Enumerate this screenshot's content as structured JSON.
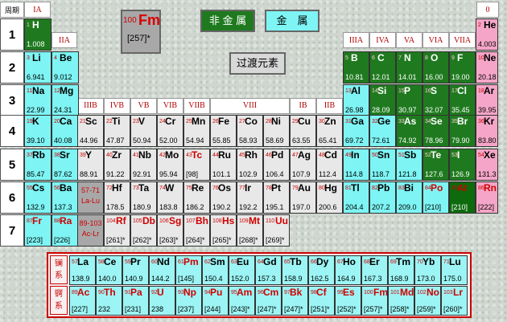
{
  "corner": "周期",
  "periods": [
    "1",
    "2",
    "3",
    "4",
    "5",
    "6",
    "7"
  ],
  "groups_main": {
    "IA": "IA",
    "IIA": "IIA",
    "IIIA": "IIIA",
    "IVA": "IVA",
    "VA": "VA",
    "VIA": "VIA",
    "VIIA": "VIIA",
    "0": "0"
  },
  "groups_trans": [
    "IIIB",
    "IVB",
    "VB",
    "VIB",
    "VIIB",
    "VIII",
    "IB",
    "IIB"
  ],
  "legend": {
    "nonmetal": "非 金 属",
    "metal": "金　属",
    "transition": "过渡元素"
  },
  "sample": {
    "z": "100",
    "symbol": "Fm",
    "mass": "[257]*"
  },
  "colors": {
    "alkali": "#7ef4f4",
    "transition": "#e8e8e8",
    "metal": "#7ef4f4",
    "nonmetal": "#1f7a1f",
    "metalloid": "#0d6b0d",
    "noble": "#f5a6c8",
    "sample_bg": "#a8a8a8",
    "series": "#9cf4f4"
  },
  "elements": [
    {
      "z": "1",
      "s": "H",
      "m": "1.008",
      "c": "nonmetal",
      "r": 1,
      "g": 1
    },
    {
      "z": "2",
      "s": "He",
      "m": "4.003",
      "c": "noble",
      "r": 1,
      "g": 18
    },
    {
      "z": "3",
      "s": "Li",
      "m": "6.941",
      "c": "metal",
      "r": 2,
      "g": 1
    },
    {
      "z": "4",
      "s": "Be",
      "m": "9.012",
      "c": "metal",
      "r": 2,
      "g": 2
    },
    {
      "z": "5",
      "s": "B",
      "m": "10.81",
      "c": "nonmetal",
      "r": 2,
      "g": 13
    },
    {
      "z": "6",
      "s": "C",
      "m": "12.01",
      "c": "nonmetal",
      "r": 2,
      "g": 14
    },
    {
      "z": "7",
      "s": "N",
      "m": "14.01",
      "c": "nonmetal",
      "r": 2,
      "g": 15
    },
    {
      "z": "8",
      "s": "O",
      "m": "16.00",
      "c": "nonmetal",
      "r": 2,
      "g": 16
    },
    {
      "z": "9",
      "s": "F",
      "m": "19.00",
      "c": "nonmetal",
      "r": 2,
      "g": 17
    },
    {
      "z": "10",
      "s": "Ne",
      "m": "20.18",
      "c": "noble",
      "r": 2,
      "g": 18
    },
    {
      "z": "11",
      "s": "Na",
      "m": "22.99",
      "c": "metal",
      "r": 3,
      "g": 1
    },
    {
      "z": "12",
      "s": "Mg",
      "m": "24.31",
      "c": "metal",
      "r": 3,
      "g": 2
    },
    {
      "z": "13",
      "s": "Al",
      "m": "26.98",
      "c": "metal",
      "r": 3,
      "g": 13
    },
    {
      "z": "14",
      "s": "Si",
      "m": "28.09",
      "c": "nonmetal",
      "r": 3,
      "g": 14
    },
    {
      "z": "15",
      "s": "P",
      "m": "30.97",
      "c": "nonmetal",
      "r": 3,
      "g": 15
    },
    {
      "z": "16",
      "s": "S",
      "m": "32.07",
      "c": "nonmetal",
      "r": 3,
      "g": 16
    },
    {
      "z": "17",
      "s": "Cl",
      "m": "35.45",
      "c": "nonmetal",
      "r": 3,
      "g": 17
    },
    {
      "z": "18",
      "s": "Ar",
      "m": "39.95",
      "c": "noble",
      "r": 3,
      "g": 18
    },
    {
      "z": "19",
      "s": "K",
      "m": "39.10",
      "c": "metal",
      "r": 4,
      "g": 1
    },
    {
      "z": "20",
      "s": "Ca",
      "m": "40.08",
      "c": "metal",
      "r": 4,
      "g": 2
    },
    {
      "z": "21",
      "s": "Sc",
      "m": "44.96",
      "c": "transition",
      "r": 4,
      "g": 3
    },
    {
      "z": "22",
      "s": "Ti",
      "m": "47.87",
      "c": "transition",
      "r": 4,
      "g": 4
    },
    {
      "z": "23",
      "s": "V",
      "m": "50.94",
      "c": "transition",
      "r": 4,
      "g": 5
    },
    {
      "z": "24",
      "s": "Cr",
      "m": "52.00",
      "c": "transition",
      "r": 4,
      "g": 6
    },
    {
      "z": "25",
      "s": "Mn",
      "m": "54.94",
      "c": "transition",
      "r": 4,
      "g": 7
    },
    {
      "z": "26",
      "s": "Fe",
      "m": "55.85",
      "c": "transition",
      "r": 4,
      "g": 8
    },
    {
      "z": "27",
      "s": "Co",
      "m": "58.93",
      "c": "transition",
      "r": 4,
      "g": 9
    },
    {
      "z": "28",
      "s": "Ni",
      "m": "58.69",
      "c": "transition",
      "r": 4,
      "g": 10
    },
    {
      "z": "29",
      "s": "Cu",
      "m": "63.55",
      "c": "transition",
      "r": 4,
      "g": 11
    },
    {
      "z": "30",
      "s": "Zn",
      "m": "65.41",
      "c": "transition",
      "r": 4,
      "g": 12
    },
    {
      "z": "31",
      "s": "Ga",
      "m": "69.72",
      "c": "metal",
      "r": 4,
      "g": 13
    },
    {
      "z": "32",
      "s": "Ge",
      "m": "72.61",
      "c": "metal",
      "r": 4,
      "g": 14
    },
    {
      "z": "33",
      "s": "As",
      "m": "74.92",
      "c": "nonmetal",
      "r": 4,
      "g": 15
    },
    {
      "z": "34",
      "s": "Se",
      "m": "78.96",
      "c": "nonmetal",
      "r": 4,
      "g": 16
    },
    {
      "z": "35",
      "s": "Br",
      "m": "79.90",
      "c": "nonmetal",
      "r": 4,
      "g": 17
    },
    {
      "z": "36",
      "s": "Kr",
      "m": "83.80",
      "c": "noble",
      "r": 4,
      "g": 18
    },
    {
      "z": "37",
      "s": "Rb",
      "m": "85.47",
      "c": "metal",
      "r": 5,
      "g": 1
    },
    {
      "z": "38",
      "s": "Sr",
      "m": "87.62",
      "c": "metal",
      "r": 5,
      "g": 2
    },
    {
      "z": "39",
      "s": "Y",
      "m": "88.91",
      "c": "transition",
      "r": 5,
      "g": 3
    },
    {
      "z": "40",
      "s": "Zr",
      "m": "91.22",
      "c": "transition",
      "r": 5,
      "g": 4
    },
    {
      "z": "41",
      "s": "Nb",
      "m": "92.91",
      "c": "transition",
      "r": 5,
      "g": 5
    },
    {
      "z": "42",
      "s": "Mo",
      "m": "95.94",
      "c": "transition",
      "r": 5,
      "g": 6
    },
    {
      "z": "43",
      "s": "Tc",
      "m": "[98]",
      "c": "transition",
      "r": 5,
      "g": 7,
      "red": true
    },
    {
      "z": "44",
      "s": "Ru",
      "m": "101.1",
      "c": "transition",
      "r": 5,
      "g": 8
    },
    {
      "z": "45",
      "s": "Rh",
      "m": "102.9",
      "c": "transition",
      "r": 5,
      "g": 9
    },
    {
      "z": "46",
      "s": "Pd",
      "m": "106.4",
      "c": "transition",
      "r": 5,
      "g": 10
    },
    {
      "z": "47",
      "s": "Ag",
      "m": "107.9",
      "c": "transition",
      "r": 5,
      "g": 11
    },
    {
      "z": "48",
      "s": "Cd",
      "m": "112.4",
      "c": "transition",
      "r": 5,
      "g": 12
    },
    {
      "z": "49",
      "s": "In",
      "m": "114.8",
      "c": "metal",
      "r": 5,
      "g": 13
    },
    {
      "z": "50",
      "s": "Sn",
      "m": "118.7",
      "c": "metal",
      "r": 5,
      "g": 14
    },
    {
      "z": "51",
      "s": "Sb",
      "m": "121.8",
      "c": "metal",
      "r": 5,
      "g": 15
    },
    {
      "z": "52",
      "s": "Te",
      "m": "127.6",
      "c": "nonmetal",
      "r": 5,
      "g": 16
    },
    {
      "z": "53",
      "s": "I",
      "m": "126.9",
      "c": "nonmetal",
      "r": 5,
      "g": 17
    },
    {
      "z": "54",
      "s": "Xe",
      "m": "131.3",
      "c": "noble",
      "r": 5,
      "g": 18
    },
    {
      "z": "55",
      "s": "Cs",
      "m": "132.9",
      "c": "metal",
      "r": 6,
      "g": 1
    },
    {
      "z": "56",
      "s": "Ba",
      "m": "137.3",
      "c": "metal",
      "r": 6,
      "g": 2
    },
    {
      "z": "72",
      "s": "Hf",
      "m": "178.5",
      "c": "transition",
      "r": 6,
      "g": 4
    },
    {
      "z": "73",
      "s": "Ta",
      "m": "180.9",
      "c": "transition",
      "r": 6,
      "g": 5
    },
    {
      "z": "74",
      "s": "W",
      "m": "183.8",
      "c": "transition",
      "r": 6,
      "g": 6
    },
    {
      "z": "75",
      "s": "Re",
      "m": "186.2",
      "c": "transition",
      "r": 6,
      "g": 7
    },
    {
      "z": "76",
      "s": "Os",
      "m": "190.2",
      "c": "transition",
      "r": 6,
      "g": 8
    },
    {
      "z": "77",
      "s": "Ir",
      "m": "192.2",
      "c": "transition",
      "r": 6,
      "g": 9
    },
    {
      "z": "78",
      "s": "Pt",
      "m": "195.1",
      "c": "transition",
      "r": 6,
      "g": 10
    },
    {
      "z": "79",
      "s": "Au",
      "m": "197.0",
      "c": "transition",
      "r": 6,
      "g": 11
    },
    {
      "z": "80",
      "s": "Hg",
      "m": "200.6",
      "c": "transition",
      "r": 6,
      "g": 12
    },
    {
      "z": "81",
      "s": "Tl",
      "m": "204.4",
      "c": "metal",
      "r": 6,
      "g": 13
    },
    {
      "z": "82",
      "s": "Pb",
      "m": "207.2",
      "c": "metal",
      "r": 6,
      "g": 14
    },
    {
      "z": "83",
      "s": "Bi",
      "m": "209.0",
      "c": "metal",
      "r": 6,
      "g": 15
    },
    {
      "z": "84",
      "s": "Po",
      "m": "[210]",
      "c": "metal",
      "r": 6,
      "g": 16,
      "red": true
    },
    {
      "z": "85",
      "s": "At",
      "m": "[210]",
      "c": "metalloid",
      "r": 6,
      "g": 17,
      "red": true
    },
    {
      "z": "86",
      "s": "Rn",
      "m": "[222]",
      "c": "noble",
      "r": 6,
      "g": 18,
      "red": true
    },
    {
      "z": "87",
      "s": "Fr",
      "m": "[223]",
      "c": "metal",
      "r": 7,
      "g": 1,
      "red": true
    },
    {
      "z": "88",
      "s": "Ra",
      "m": "[226]",
      "c": "metal",
      "r": 7,
      "g": 2,
      "red": true
    },
    {
      "z": "104",
      "s": "Rf",
      "m": "[261]*",
      "c": "transition",
      "r": 7,
      "g": 4,
      "red": true
    },
    {
      "z": "105",
      "s": "Db",
      "m": "[262]*",
      "c": "transition",
      "r": 7,
      "g": 5,
      "red": true
    },
    {
      "z": "106",
      "s": "Sg",
      "m": "[263]*",
      "c": "transition",
      "r": 7,
      "g": 6,
      "red": true
    },
    {
      "z": "107",
      "s": "Bh",
      "m": "[264]*",
      "c": "transition",
      "r": 7,
      "g": 7,
      "red": true
    },
    {
      "z": "108",
      "s": "Hs",
      "m": "[265]*",
      "c": "transition",
      "r": 7,
      "g": 8,
      "red": true
    },
    {
      "z": "109",
      "s": "Mt",
      "m": "[268]*",
      "c": "transition",
      "r": 7,
      "g": 9,
      "red": true
    },
    {
      "z": "110",
      "s": "Uu",
      "m": "[269]*",
      "c": "transition",
      "r": 7,
      "g": 10,
      "red": true
    }
  ],
  "placeholders": [
    {
      "text": "57-71",
      "text2": "La-Lu",
      "r": 6
    },
    {
      "text": "89-103",
      "text2": "Ac-Lr",
      "r": 7
    }
  ],
  "series_labels": {
    "lanthanide": "镧\n系",
    "actinide": "锕\n系"
  },
  "lanthanides": [
    {
      "z": "57",
      "s": "La",
      "m": "138.9"
    },
    {
      "z": "58",
      "s": "Ce",
      "m": "140.0"
    },
    {
      "z": "59",
      "s": "Pr",
      "m": "140.9"
    },
    {
      "z": "60",
      "s": "Nd",
      "m": "144.2"
    },
    {
      "z": "61",
      "s": "Pm",
      "m": "[145]",
      "red": true
    },
    {
      "z": "62",
      "s": "Sm",
      "m": "150.4"
    },
    {
      "z": "63",
      "s": "Eu",
      "m": "152.0"
    },
    {
      "z": "64",
      "s": "Gd",
      "m": "157.3"
    },
    {
      "z": "65",
      "s": "Tb",
      "m": "158.9"
    },
    {
      "z": "66",
      "s": "Dy",
      "m": "162.5"
    },
    {
      "z": "67",
      "s": "Ho",
      "m": "164.9"
    },
    {
      "z": "68",
      "s": "Er",
      "m": "167.3"
    },
    {
      "z": "69",
      "s": "Tm",
      "m": "168.9"
    },
    {
      "z": "70",
      "s": "Yb",
      "m": "173.0"
    },
    {
      "z": "71",
      "s": "Lu",
      "m": "175.0"
    }
  ],
  "actinides": [
    {
      "z": "89",
      "s": "Ac",
      "m": "[227]",
      "red": true
    },
    {
      "z": "90",
      "s": "Th",
      "m": "232",
      "red": true
    },
    {
      "z": "91",
      "s": "Pa",
      "m": "[231]",
      "red": true
    },
    {
      "z": "92",
      "s": "U",
      "m": "238",
      "red": true
    },
    {
      "z": "93",
      "s": "Np",
      "m": "[237]",
      "red": true
    },
    {
      "z": "94",
      "s": "Pu",
      "m": "[244]",
      "red": true
    },
    {
      "z": "95",
      "s": "Am",
      "m": "[243]*",
      "red": true
    },
    {
      "z": "96",
      "s": "Cm",
      "m": "[247]*",
      "red": true
    },
    {
      "z": "97",
      "s": "Bk",
      "m": "[247]*",
      "red": true
    },
    {
      "z": "98",
      "s": "Cf",
      "m": "[251]*",
      "red": true
    },
    {
      "z": "99",
      "s": "Es",
      "m": "[252]*",
      "red": true
    },
    {
      "z": "100",
      "s": "Fm",
      "m": "[257]*",
      "red": true
    },
    {
      "z": "101",
      "s": "Md",
      "m": "[258]*",
      "red": true
    },
    {
      "z": "102",
      "s": "No",
      "m": "[259]*",
      "red": true
    },
    {
      "z": "103",
      "s": "Lr",
      "m": "[260]*",
      "red": true
    }
  ]
}
